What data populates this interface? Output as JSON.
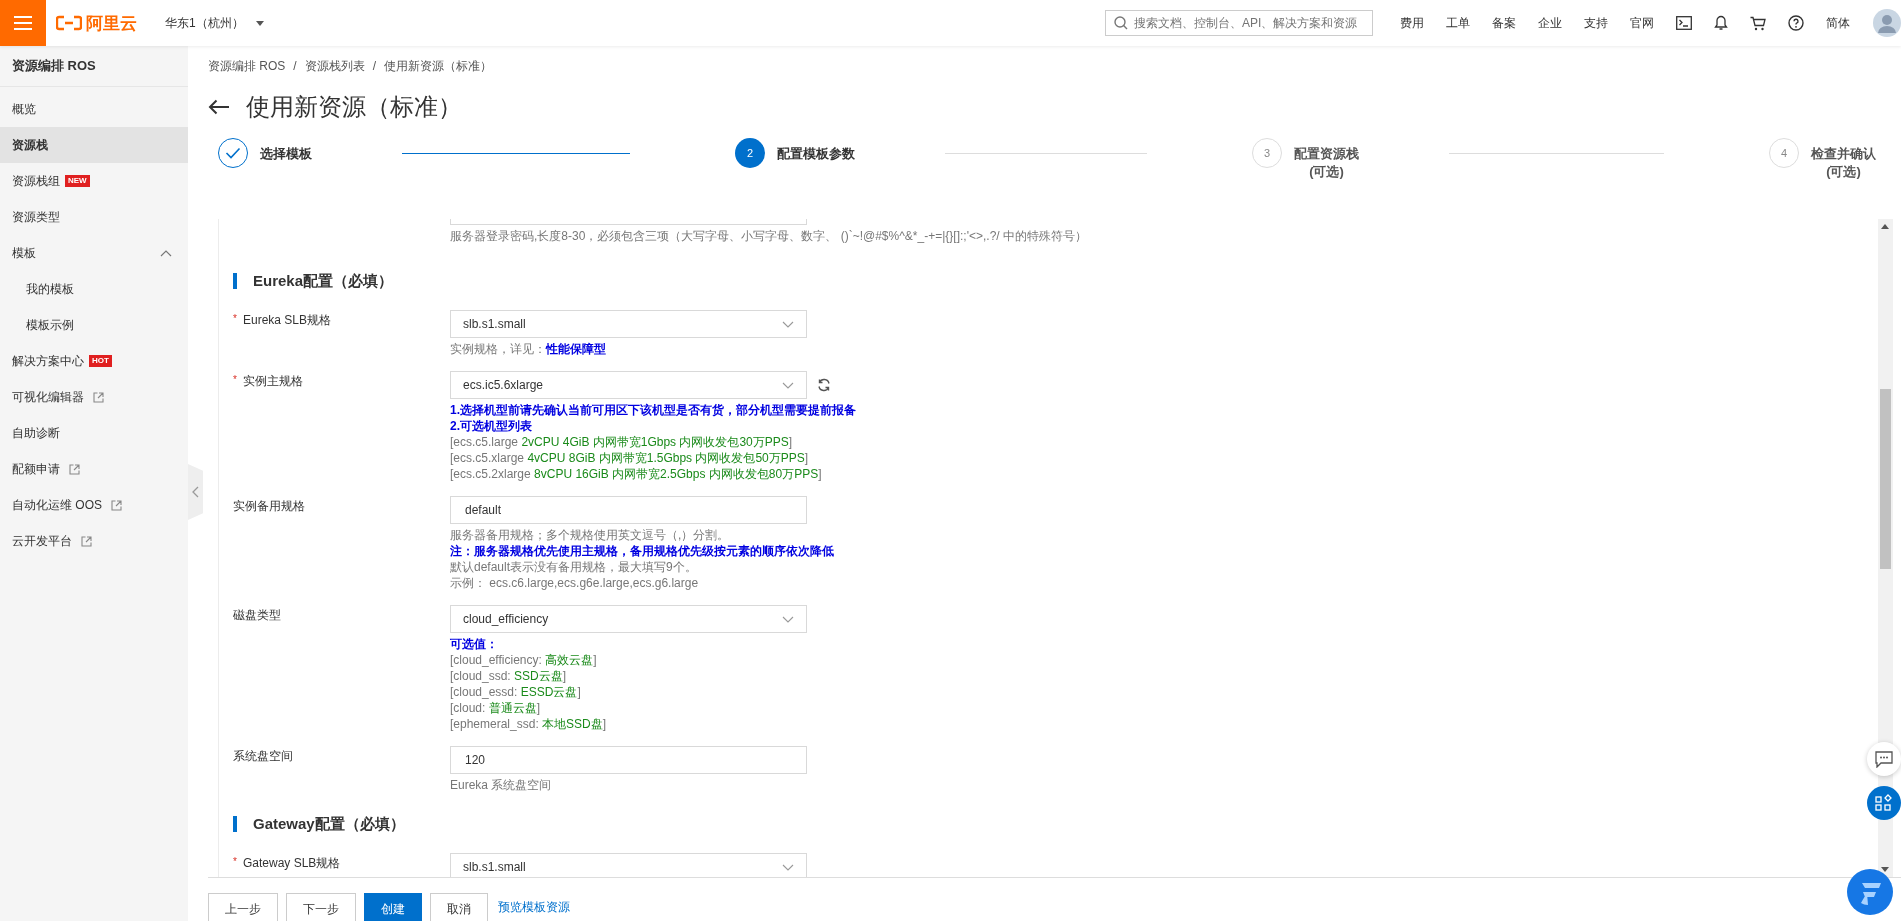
{
  "topbar": {
    "logo": "阿里云",
    "region": "华东1（杭州）",
    "search_placeholder": "搜索文档、控制台、API、解决方案和资源",
    "nav": [
      "费用",
      "工单",
      "备案",
      "企业",
      "支持",
      "官网"
    ],
    "language": "简体"
  },
  "sidebar": {
    "title": "资源编排 ROS",
    "items": [
      {
        "label": "概览",
        "selected": false,
        "external": false
      },
      {
        "label": "资源栈",
        "selected": true,
        "external": false
      },
      {
        "label": "资源栈组",
        "selected": false,
        "external": false,
        "badge": "NEW"
      },
      {
        "label": "资源类型",
        "selected": false,
        "external": false
      },
      {
        "label": "模板",
        "selected": false,
        "external": false,
        "expanded": true,
        "children": [
          {
            "label": "我的模板",
            "selected": false
          },
          {
            "label": "模板示例",
            "selected": false
          }
        ]
      },
      {
        "label": "解决方案中心",
        "selected": false,
        "external": false,
        "badge": "HOT"
      },
      {
        "label": "可视化编辑器",
        "selected": false,
        "external": true
      },
      {
        "label": "自助诊断",
        "selected": false,
        "external": false
      },
      {
        "label": "配额申请",
        "selected": false,
        "external": true
      },
      {
        "label": "自动化运维 OOS",
        "selected": false,
        "external": true
      },
      {
        "label": "云开发平台",
        "selected": false,
        "external": true
      }
    ]
  },
  "breadcrumb": [
    {
      "label": "资源编排 ROS"
    },
    {
      "separator": "/",
      "label": "资源栈列表"
    },
    {
      "separator": "/",
      "label": "使用新资源（标准）"
    }
  ],
  "title": "使用新资源（标准）",
  "steps": [
    {
      "label": "选择模板",
      "kind": "done"
    },
    {
      "number": "2",
      "label": "配置模板参数",
      "kind": "active"
    },
    {
      "number": "3",
      "label": "配置资源栈",
      "sublabel": "(可选)",
      "kind": "pending"
    },
    {
      "number": "4",
      "label": "检查并确认",
      "sublabel": "(可选)",
      "kind": "pending"
    }
  ],
  "form": [
    {
      "kind": "partial",
      "help": [
        [
          {
            "text": "服务器登录密码,长度8-30，必须包含三项（大写字母、小写字母、数字、 ()`~!@#$%^&*_-+=|{}[]:;'<>,.?/ 中的特殊符号）",
            "kind": "grey"
          }
        ]
      ]
    },
    {
      "kind": "section",
      "label": "Eureka配置（必填）"
    },
    {
      "kind": "select",
      "mark": "*",
      "label": "Eureka SLB规格",
      "value": "slb.s1.small",
      "help": [
        [
          {
            "text": "实例规格，详见：",
            "kind": "grey"
          },
          {
            "text": "性能保障型",
            "kind": "link"
          }
        ]
      ]
    },
    {
      "kind": "select",
      "mark": "*",
      "label": "实例主规格",
      "value": "ecs.ic5.6xlarge",
      "refresh": true,
      "help": [
        [
          {
            "text": "1.选择机型前请先确认当前可用区下该机型是否有货，部分机型需要提前报备",
            "kind": "blue"
          }
        ],
        [
          {
            "text": "2.可选机型列表",
            "kind": "blue"
          }
        ],
        [
          {
            "text": "[ecs.c5.large",
            "kind": "grey"
          },
          {
            "text": " 2vCPU 4GiB 内网带宽1Gbps 内网收发包30万PPS",
            "kind": "green"
          },
          {
            "text": "]",
            "kind": "grey"
          }
        ],
        [
          {
            "text": "[ecs.c5.xlarge",
            "kind": "grey"
          },
          {
            "text": " 4vCPU 8GiB 内网带宽1.5Gbps 内网收发包50万PPS",
            "kind": "green"
          },
          {
            "text": "]",
            "kind": "grey"
          }
        ],
        [
          {
            "text": "[ecs.c5.2xlarge",
            "kind": "grey"
          },
          {
            "text": " 8vCPU 16GiB 内网带宽2.5Gbps 内网收发包80万PPS",
            "kind": "green"
          },
          {
            "text": "]",
            "kind": "grey"
          }
        ]
      ]
    },
    {
      "kind": "input",
      "label": "实例备用规格",
      "value": "default",
      "help": [
        [
          {
            "text": "服务器备用规格；多个规格使用英文逗号（,）分割。",
            "kind": "grey"
          }
        ],
        [
          {
            "text": "注：服务器规格优先使用主规格，备用规格优先级按元素的顺序依次降低",
            "kind": "blue"
          }
        ],
        [
          {
            "text": "默认default表示没有备用规格，最大填写9个。",
            "kind": "grey"
          }
        ],
        [
          {
            "text": "示例：  ecs.c6.large,ecs.g6e.large,ecs.g6.large",
            "kind": "grey"
          }
        ]
      ]
    },
    {
      "kind": "select",
      "label": "磁盘类型",
      "value": "cloud_efficiency",
      "help": [
        [
          {
            "text": "可选值：",
            "kind": "blue"
          }
        ],
        [
          {
            "text": "[cloud_efficiency: ",
            "kind": "grey"
          },
          {
            "text": "高效云盘",
            "kind": "green"
          },
          {
            "text": "]",
            "kind": "grey"
          }
        ],
        [
          {
            "text": "[cloud_ssd: ",
            "kind": "grey"
          },
          {
            "text": "SSD云盘",
            "kind": "green"
          },
          {
            "text": "]",
            "kind": "grey"
          }
        ],
        [
          {
            "text": "[cloud_essd: ",
            "kind": "grey"
          },
          {
            "text": "ESSD云盘",
            "kind": "green"
          },
          {
            "text": "]",
            "kind": "grey"
          }
        ],
        [
          {
            "text": "[cloud: ",
            "kind": "grey"
          },
          {
            "text": "普通云盘",
            "kind": "green"
          },
          {
            "text": "]",
            "kind": "grey"
          }
        ],
        [
          {
            "text": "[ephemeral_ssd: ",
            "kind": "grey"
          },
          {
            "text": "本地SSD盘",
            "kind": "green"
          },
          {
            "text": "]",
            "kind": "grey"
          }
        ]
      ]
    },
    {
      "kind": "input",
      "label": "系统盘空间",
      "value": "120",
      "help": [
        [
          {
            "text": "Eureka 系统盘空间",
            "kind": "grey"
          }
        ]
      ]
    },
    {
      "kind": "section",
      "label": "Gateway配置（必填）"
    },
    {
      "kind": "select",
      "mark": "*",
      "label": "Gateway SLB规格",
      "value": "slb.s1.small"
    }
  ],
  "footer": [
    {
      "label": "上一步",
      "kind": "default"
    },
    {
      "label": "下一步",
      "kind": "default"
    },
    {
      "label": "创建",
      "kind": "primary"
    },
    {
      "label": "取消",
      "kind": "default"
    },
    {
      "label": "预览模板资源",
      "kind": "link"
    }
  ]
}
